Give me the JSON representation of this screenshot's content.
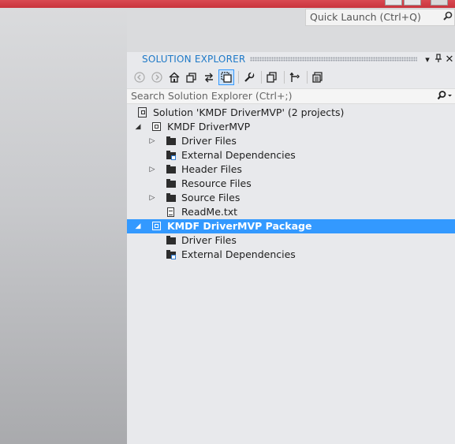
{
  "quick_launch": {
    "placeholder": "Quick Launch (Ctrl+Q)",
    "icon": "search-icon"
  },
  "panel": {
    "title": "SOLUTION EXPLORER",
    "header_icons": [
      "dropdown-arrow-icon",
      "pin-icon",
      "close-icon"
    ]
  },
  "toolbar": {
    "buttons": [
      {
        "name": "back-icon",
        "enabled": false
      },
      {
        "name": "forward-icon",
        "enabled": false
      },
      {
        "name": "home-icon",
        "enabled": true
      },
      {
        "name": "switch-views-icon",
        "enabled": true
      },
      {
        "name": "sync-icon",
        "enabled": true
      },
      {
        "name": "show-all-files-icon",
        "enabled": true,
        "active": true
      },
      {
        "name": "properties-wrench-icon",
        "enabled": true
      },
      {
        "name": "collapse-all-icon",
        "enabled": true
      },
      {
        "name": "pending-changes-icon",
        "enabled": true
      },
      {
        "name": "preview-icon",
        "enabled": true
      }
    ]
  },
  "search": {
    "placeholder": "Search Solution Explorer (Ctrl+;)",
    "icon": "search-icon"
  },
  "tree": {
    "solution": "Solution 'KMDF DriverMVP' (2 projects)",
    "project1": {
      "label": "KMDF DriverMVP",
      "items": [
        "Driver Files",
        "External Dependencies",
        "Header Files",
        "Resource Files",
        "Source Files",
        "ReadMe.txt"
      ]
    },
    "project2": {
      "label": "KMDF DriverMVP Package",
      "items": [
        "Driver Files",
        "External Dependencies"
      ]
    }
  },
  "colors": {
    "accent": "#1e79c7",
    "selection": "#3399ff",
    "panel_bg": "#e8e9ec"
  }
}
